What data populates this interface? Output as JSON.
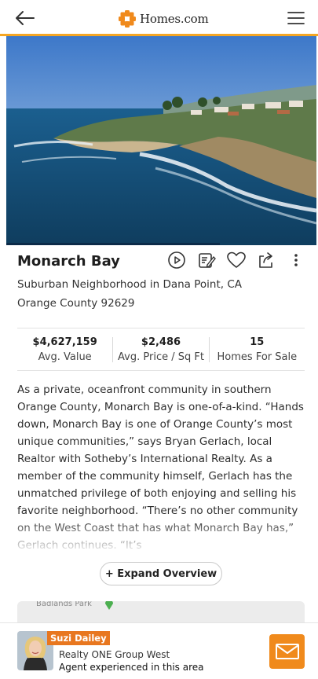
{
  "header": {
    "logo_text": "Homes.com",
    "back_icon": "arrow-left-icon",
    "menu_icon": "hamburger-menu-icon"
  },
  "hero": {
    "image": "coastal aerial photo"
  },
  "neighborhood": {
    "name": "Monarch Bay",
    "type_line": "Suburban Neighborhood in Dana Point, CA",
    "county_line": "Orange County 92629",
    "actions": [
      "play-icon",
      "notes-icon",
      "heart-icon",
      "share-icon",
      "more-vertical-icon"
    ]
  },
  "stats": [
    {
      "value": "$4,627,159",
      "label": "Avg. Value"
    },
    {
      "value": "$2,486",
      "label": "Avg. Price / Sq Ft"
    },
    {
      "value": "15",
      "label": "Homes For Sale"
    }
  ],
  "overview": {
    "text": "As a private, oceanfront community in southern Orange County, Monarch Bay is one-of-a-kind. “Hands down, Monarch Bay is one of Orange County’s most unique communities,” says Bryan Gerlach, local Realtor with Sotheby’s International Realty. As a member of the community himself, Gerlach has the unmatched privilege of both enjoying and selling his favorite neighborhood. “There’s no other community on the West Coast that has what Monarch Bay has,” Gerlach continues. “It’s",
    "expand_label": "+ Expand Overview"
  },
  "map": {
    "label": "Badlands Park"
  },
  "agent": {
    "name": "Suzi Dailey",
    "company": "Realty ONE Group West",
    "tagline": "Agent experienced in this area"
  },
  "colors": {
    "accent": "#f08a1c",
    "brand_orange": "#e8771f",
    "text": "#1f1f1f"
  }
}
